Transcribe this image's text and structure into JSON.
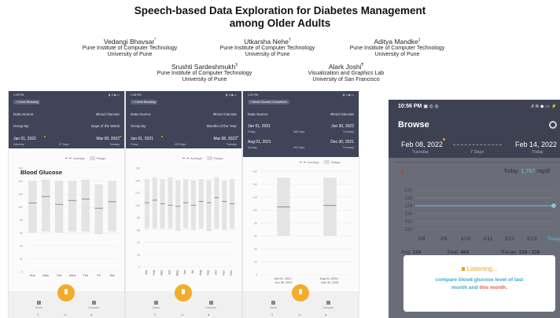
{
  "paper": {
    "title_line1": "Speech-based Data Exploration for Diabetes Management",
    "title_line2": "among Older Adults",
    "authors": [
      {
        "name": "Vedangi Bhavsar",
        "mark": "*",
        "aff1": "Pune Institute of Computer Technology",
        "aff2": "University of Pune"
      },
      {
        "name": "Utkarsha Nehe",
        "mark": "†",
        "aff1": "Pune Institute of Computer Technology",
        "aff2": "University of Pune"
      },
      {
        "name": "Aditya Mandke",
        "mark": "‡",
        "aff1": "Pune Institute of Computer Technology",
        "aff2": "University of Pune"
      },
      {
        "name": "Srushti Sardeshmukh",
        "mark": "§",
        "aff1": "Pune Institute of Computer Technology",
        "aff2": "University of Pune"
      },
      {
        "name": "Alark Joshi",
        "mark": "¶",
        "aff1": "Visualization and Graphics Lab",
        "aff2": "University of San Francisco"
      }
    ]
  },
  "phones": [
    {
      "status_time": "1:28 PM",
      "status_right": "▮ .ıl ◆ ▭",
      "back_label": "< Home Browsing",
      "row1_label": "Data Source",
      "row1_value": "Blood Glucose",
      "row2_label": "Group By",
      "row2_value": "Days of the Week",
      "start": "Jan 01, 2022",
      "start_sub": "Saturday",
      "mid": "67 Days",
      "end": "Mar 08, 2022",
      "end_sub": "Tuesday",
      "legend_avg": "Average",
      "legend_range": "Range",
      "y_ticks": [
        "160",
        "140",
        "120",
        "100",
        "80",
        "60",
        "40",
        "20",
        "0"
      ],
      "nav": {
        "left": "Home",
        "right": "Compare"
      }
    },
    {
      "status_time": "1:28 PM",
      "status_right": "▮ .ıl ◆ ▭",
      "back_label": "< Home Browsing",
      "row1_label": "Data Source",
      "row1_value": "Blood Glucose",
      "row2_label": "Group By",
      "row2_value": "Months of the Year",
      "start": "Jan 01, 2021",
      "start_sub": "Friday",
      "mid": "432 Days",
      "end": "Mar 08, 2022",
      "end_sub": "Tuesday",
      "legend_avg": "Average",
      "legend_range": "Range",
      "y_ticks": [
        "160",
        "140",
        "120",
        "100",
        "80",
        "60",
        "40",
        "20",
        "0"
      ],
      "nav": {
        "left": "Home",
        "right": "Compare"
      }
    },
    {
      "status_time": "1:31 PM",
      "status_right": "▮ .ıl ◆ ▭",
      "back_label": "< Blood Glucose Comparison",
      "row1_label": "Data Source",
      "row1_value": "Blood Glucose",
      "range1_start": "Jan 01, 2021",
      "range1_start_sub": "Friday",
      "range1_mid": "366 Days",
      "range1_end": "Jun 30, 2022",
      "range1_end_sub": "Thursday",
      "range2_start": "Aug 01, 2021",
      "range2_start_sub": "Sunday",
      "range2_mid": "152 Days",
      "range2_end": "Dec 30, 2021",
      "range2_end_sub": "Thursday",
      "legend_avg": "Average",
      "legend_range": "Range",
      "y_ticks": [
        "160",
        "140",
        "120",
        "100",
        "80",
        "60",
        "40",
        "20",
        "0"
      ],
      "nav": {
        "left": "Home",
        "right": "Compare"
      }
    }
  ],
  "browse_phone": {
    "status_time": "10:56 PM",
    "status_icons": "▣ ◎ ◎",
    "status_right": ".ıl ≋ ◆ ▭ ⚡",
    "title": "Browse",
    "start_date": "Feb 08, 2022",
    "start_sub": "Tuesday",
    "mid": "7 Days",
    "end_date": "Feb 14, 2022",
    "end_sub": "Today",
    "metric_title": "Blood Glucose",
    "today_label": "Today:",
    "today_value": "1,767",
    "today_unit": "mg/dl",
    "y_ticks": [
      "120",
      "118",
      "116",
      "114",
      "112",
      "110"
    ],
    "x_ticks": [
      "2/8",
      "2/9",
      "2/10",
      "2/11",
      "2/12",
      "2/13",
      "Today"
    ],
    "avg_label": "Avg:",
    "avg_value": "116",
    "total_label": "Total:",
    "total_value": "464",
    "range_label": "Range:",
    "range_value": "116 - 116",
    "listening": "Listening...",
    "query_line1": "compare blood glucose level of last",
    "query_line2a": "month and",
    "query_line2b": "this month",
    "query_line2c": "."
  },
  "chart_data": [
    {
      "type": "bar",
      "categories": [
        "Sun",
        "Mon",
        "Tue",
        "Wed",
        "Thu",
        "Fri",
        "Sat"
      ],
      "series": [
        {
          "name": "Range",
          "low": [
            60,
            62,
            60,
            62,
            62,
            58,
            62
          ],
          "high": [
            140,
            142,
            140,
            140,
            142,
            135,
            140
          ]
        },
        {
          "name": "Average",
          "values": [
            106,
            116,
            104,
            110,
            112,
            98,
            108
          ]
        }
      ],
      "ylim": [
        0,
        160
      ]
    },
    {
      "type": "bar",
      "categories": [
        "Jan",
        "Feb",
        "Mar",
        "Apr",
        "May",
        "Jun",
        "Jul",
        "Aug",
        "Sep",
        "Oct",
        "Nov",
        "Dec"
      ],
      "series": [
        {
          "name": "Range",
          "low": [
            62,
            62,
            62,
            62,
            58,
            62,
            60,
            62,
            58,
            62,
            60,
            62
          ],
          "high": [
            142,
            145,
            142,
            145,
            140,
            142,
            140,
            142,
            140,
            145,
            140,
            142
          ]
        },
        {
          "name": "Average",
          "values": [
            104,
            108,
            102,
            100,
            98,
            104,
            100,
            106,
            104,
            112,
            106,
            102
          ]
        }
      ],
      "ylim": [
        0,
        160
      ]
    },
    {
      "type": "bar",
      "categories": [
        "Jan 01, 2021 - Jun 30, 2022",
        "Aug 01, 2021 - Dec 30, 2021"
      ],
      "series": [
        {
          "name": "Range",
          "low": [
            60,
            60
          ],
          "high": [
            150,
            150
          ]
        },
        {
          "name": "Average",
          "values": [
            105,
            107
          ]
        }
      ],
      "ylim": [
        0,
        160
      ]
    }
  ]
}
